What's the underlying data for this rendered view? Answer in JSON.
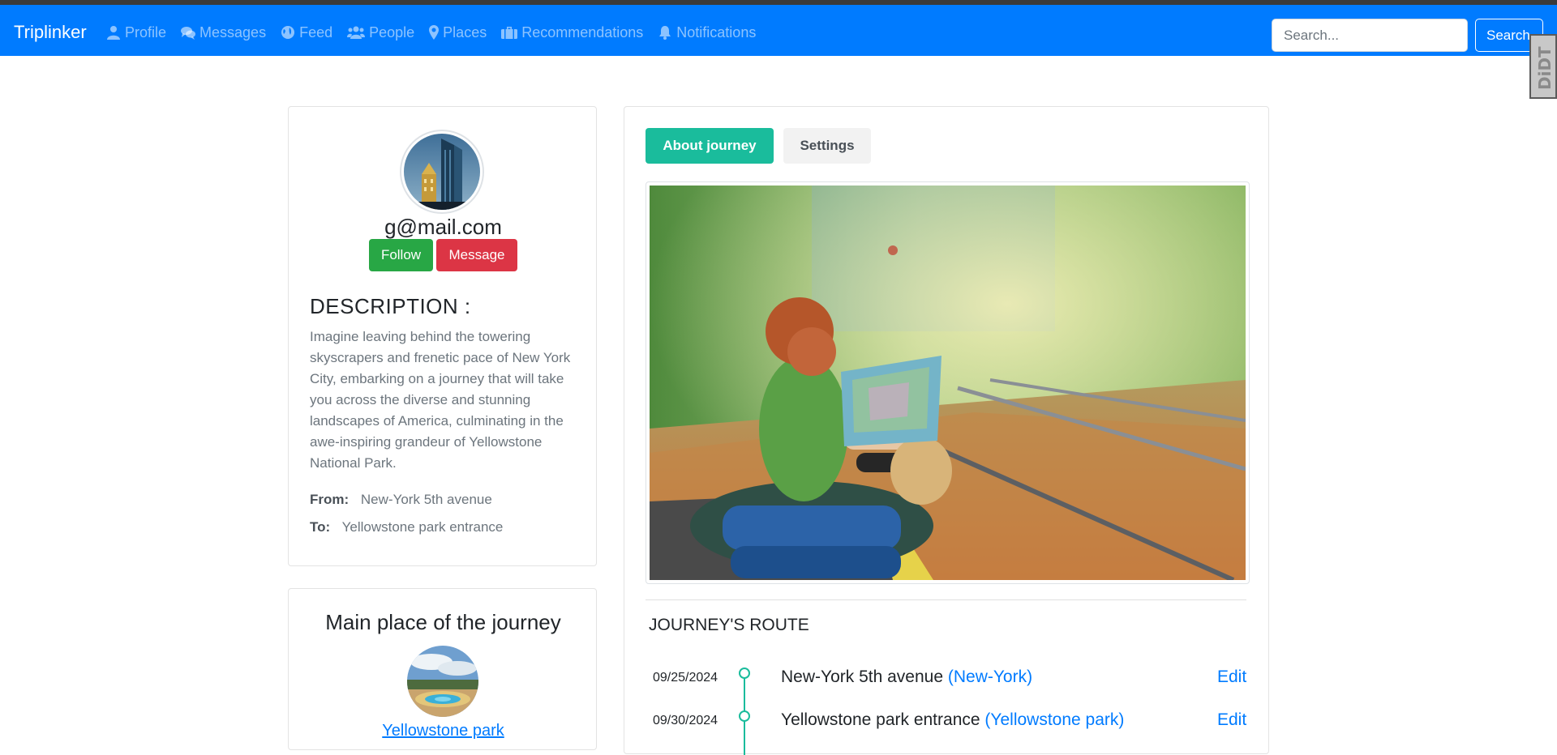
{
  "navbar": {
    "brand": "Triplinker",
    "items": [
      {
        "label": "Profile",
        "icon": "user-icon"
      },
      {
        "label": "Messages",
        "icon": "comments-icon"
      },
      {
        "label": "Feed",
        "icon": "globe-icon"
      },
      {
        "label": "People",
        "icon": "users-icon"
      },
      {
        "label": "Places",
        "icon": "map-marker-icon"
      },
      {
        "label": "Recommendations",
        "icon": "briefcase-icon"
      },
      {
        "label": "Notifications",
        "icon": "bell-icon"
      }
    ],
    "search_placeholder": "Search...",
    "search_button": "Search"
  },
  "extension_badge": "DiDT",
  "profile": {
    "username": "g@mail.com",
    "follow_label": "Follow",
    "message_label": "Message",
    "description_title": "DESCRIPTION :",
    "description": "Imagine leaving behind the towering skyscrapers and frenetic pace of New York City, embarking on a journey that will take you across the diverse and stunning landscapes of America, culminating in the awe-inspiring grandeur of Yellowstone National Park.",
    "from_label": "From:",
    "from_value": "New-York 5th avenue",
    "to_label": "To:",
    "to_value": "Yellowstone park entrance"
  },
  "main_place": {
    "title": "Main place of the journey",
    "link": "Yellowstone park"
  },
  "journey": {
    "tab_about": "About journey",
    "tab_settings": "Settings",
    "route_title": "JOURNEY'S ROUTE",
    "route": [
      {
        "date": "09/25/2024",
        "name": "New-York 5th avenue",
        "city": "(New-York)",
        "edit": "Edit"
      },
      {
        "date": "09/30/2024",
        "name": "Yellowstone park entrance",
        "city": "(Yellowstone park)",
        "edit": "Edit"
      }
    ]
  },
  "colors": {
    "navbar": "#007bff",
    "follow": "#28a745",
    "message": "#dc3545",
    "accent": "#1abc9c",
    "link": "#007bff"
  }
}
